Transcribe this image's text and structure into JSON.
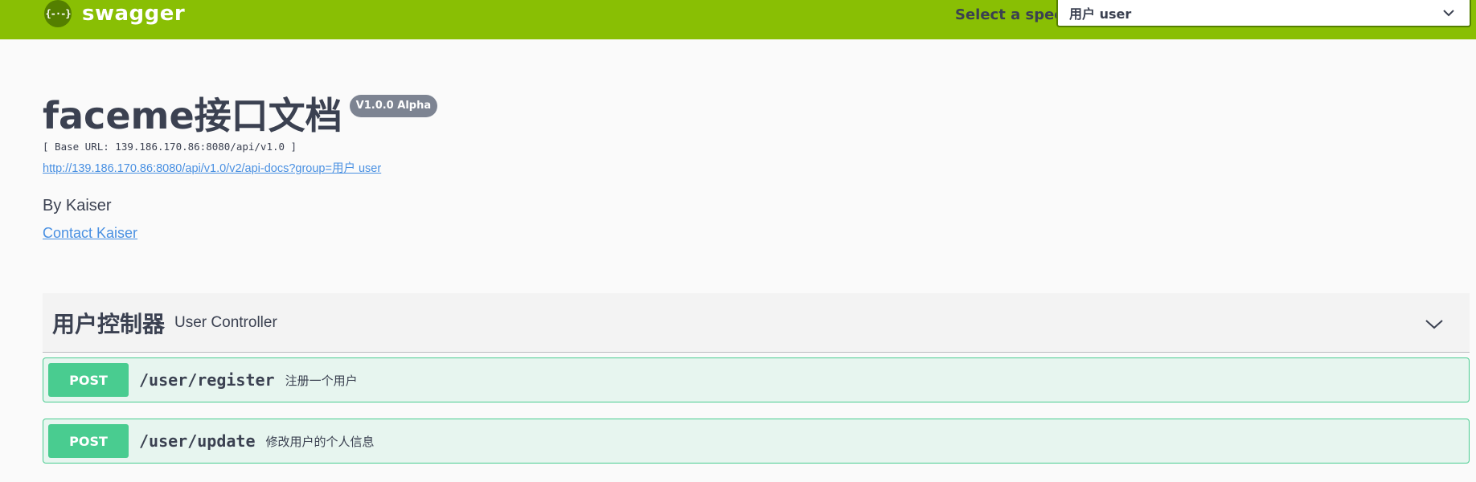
{
  "topbar": {
    "logo_glyph": "{-·-}",
    "logo_text": "swagger",
    "select_label": "Select a spec",
    "selected_spec": "用户 user",
    "icon": "chevron-down-icon"
  },
  "info": {
    "title": "faceme接口文档",
    "version": "V1.0.0 Alpha",
    "base_url": "[ Base URL: 139.186.170.86:8080/api/v1.0 ]",
    "api_docs_link": "http://139.186.170.86:8080/api/v1.0/v2/api-docs?group=用户 user",
    "author": "By Kaiser",
    "contact": "Contact Kaiser"
  },
  "tag": {
    "name": "用户控制器",
    "description": "User Controller",
    "icon": "chevron-down-icon"
  },
  "operations": [
    {
      "method": "POST",
      "path": "/user/register",
      "summary": "注册一个用户"
    },
    {
      "method": "POST",
      "path": "/user/update",
      "summary": "修改用户的个人信息"
    }
  ],
  "colors": {
    "topbar": "#89bf04",
    "post": "#49cc90",
    "link": "#4990e2",
    "text": "#3b4151"
  }
}
